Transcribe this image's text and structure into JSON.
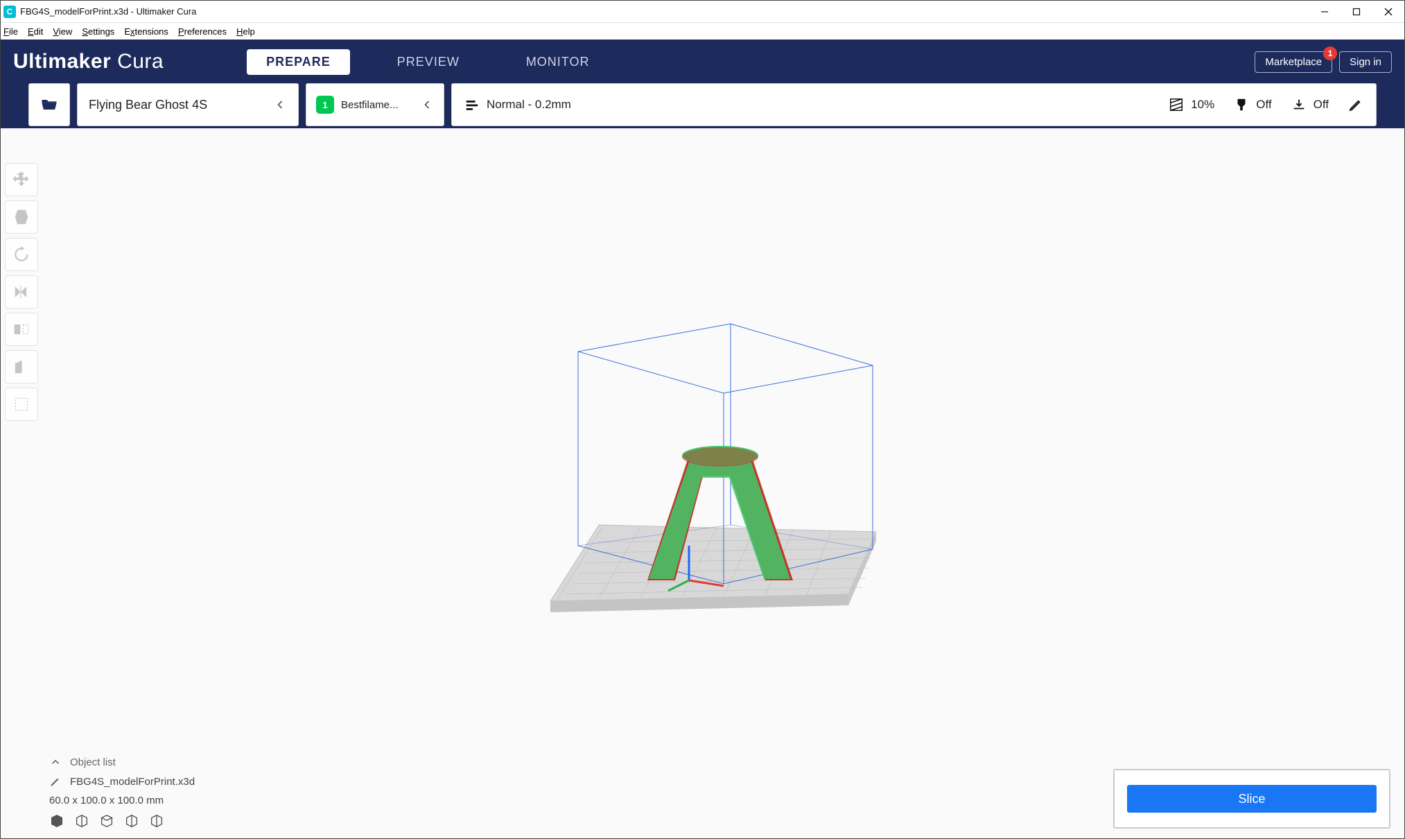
{
  "window": {
    "title": "FBG4S_modelForPrint.x3d - Ultimaker Cura",
    "app_icon_letter": "C"
  },
  "menubar": [
    "File",
    "Edit",
    "View",
    "Settings",
    "Extensions",
    "Preferences",
    "Help"
  ],
  "header": {
    "brand_bold": "Ultimaker",
    "brand_light": "Cura",
    "tabs": [
      {
        "label": "PREPARE",
        "active": true
      },
      {
        "label": "PREVIEW",
        "active": false
      },
      {
        "label": "MONITOR",
        "active": false
      }
    ],
    "marketplace_label": "Marketplace",
    "marketplace_badge": "1",
    "signin_label": "Sign in"
  },
  "config": {
    "printer": "Flying Bear Ghost 4S",
    "material_badge": "1",
    "material_label": "Bestfilame...",
    "profile_label": "Normal - 0.2mm",
    "infill_label": "10%",
    "support_label": "Off",
    "adhesion_label": "Off"
  },
  "objlist": {
    "header": "Object list",
    "filename": "FBG4S_modelForPrint.x3d",
    "dimensions": "60.0 x 100.0 x 100.0 mm"
  },
  "slice": {
    "button": "Slice"
  }
}
